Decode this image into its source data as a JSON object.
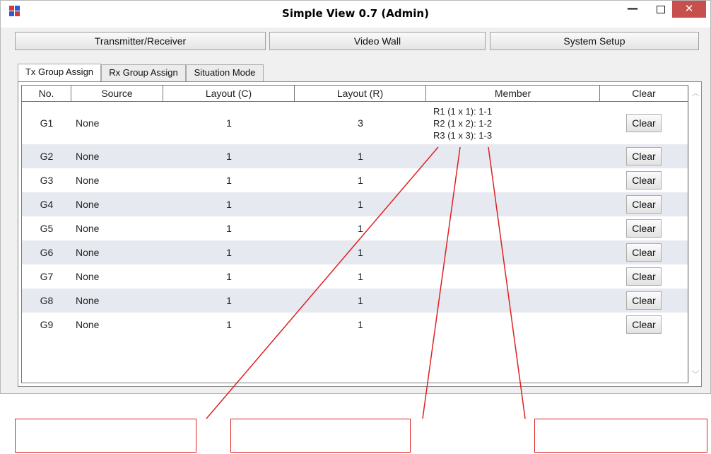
{
  "window": {
    "title": "Simple View 0.7 (Admin)",
    "minimize_glyph": "—",
    "close_glyph": "✕",
    "app_icon": "app-logo-icon"
  },
  "toolbar": {
    "buttons": [
      {
        "label": "Transmitter/Receiver"
      },
      {
        "label": "Video Wall"
      },
      {
        "label": "System Setup"
      }
    ]
  },
  "tabs": [
    {
      "label": "Tx Group Assign",
      "active": true
    },
    {
      "label": "Rx Group Assign",
      "active": false
    },
    {
      "label": "Situation Mode",
      "active": false
    }
  ],
  "table": {
    "columns": [
      "No.",
      "Source",
      "Layout (C)",
      "Layout (R)",
      "Member",
      "Clear"
    ],
    "rows": [
      {
        "no": "G1",
        "source": "None",
        "layout_c": "1",
        "layout_r": "3",
        "member": [
          "R1 (1 x 1): 1-1",
          "R2 (1 x 2): 1-2",
          "R3 (1 x 3): 1-3"
        ],
        "clear": "Clear"
      },
      {
        "no": "G2",
        "source": "None",
        "layout_c": "1",
        "layout_r": "1",
        "member": [],
        "clear": "Clear"
      },
      {
        "no": "G3",
        "source": "None",
        "layout_c": "1",
        "layout_r": "1",
        "member": [],
        "clear": "Clear"
      },
      {
        "no": "G4",
        "source": "None",
        "layout_c": "1",
        "layout_r": "1",
        "member": [],
        "clear": "Clear"
      },
      {
        "no": "G5",
        "source": "None",
        "layout_c": "1",
        "layout_r": "1",
        "member": [],
        "clear": "Clear"
      },
      {
        "no": "G6",
        "source": "None",
        "layout_c": "1",
        "layout_r": "1",
        "member": [],
        "clear": "Clear"
      },
      {
        "no": "G7",
        "source": "None",
        "layout_c": "1",
        "layout_r": "1",
        "member": [],
        "clear": "Clear"
      },
      {
        "no": "G8",
        "source": "None",
        "layout_c": "1",
        "layout_r": "1",
        "member": [],
        "clear": "Clear"
      },
      {
        "no": "G9",
        "source": "None",
        "layout_c": "1",
        "layout_r": "1",
        "member": [],
        "clear": "Clear"
      }
    ]
  },
  "colors": {
    "row_alt": "#e7e9f0",
    "close_button": "#c7504d",
    "callout": "#e02020"
  },
  "callouts": [
    "",
    "",
    ""
  ]
}
